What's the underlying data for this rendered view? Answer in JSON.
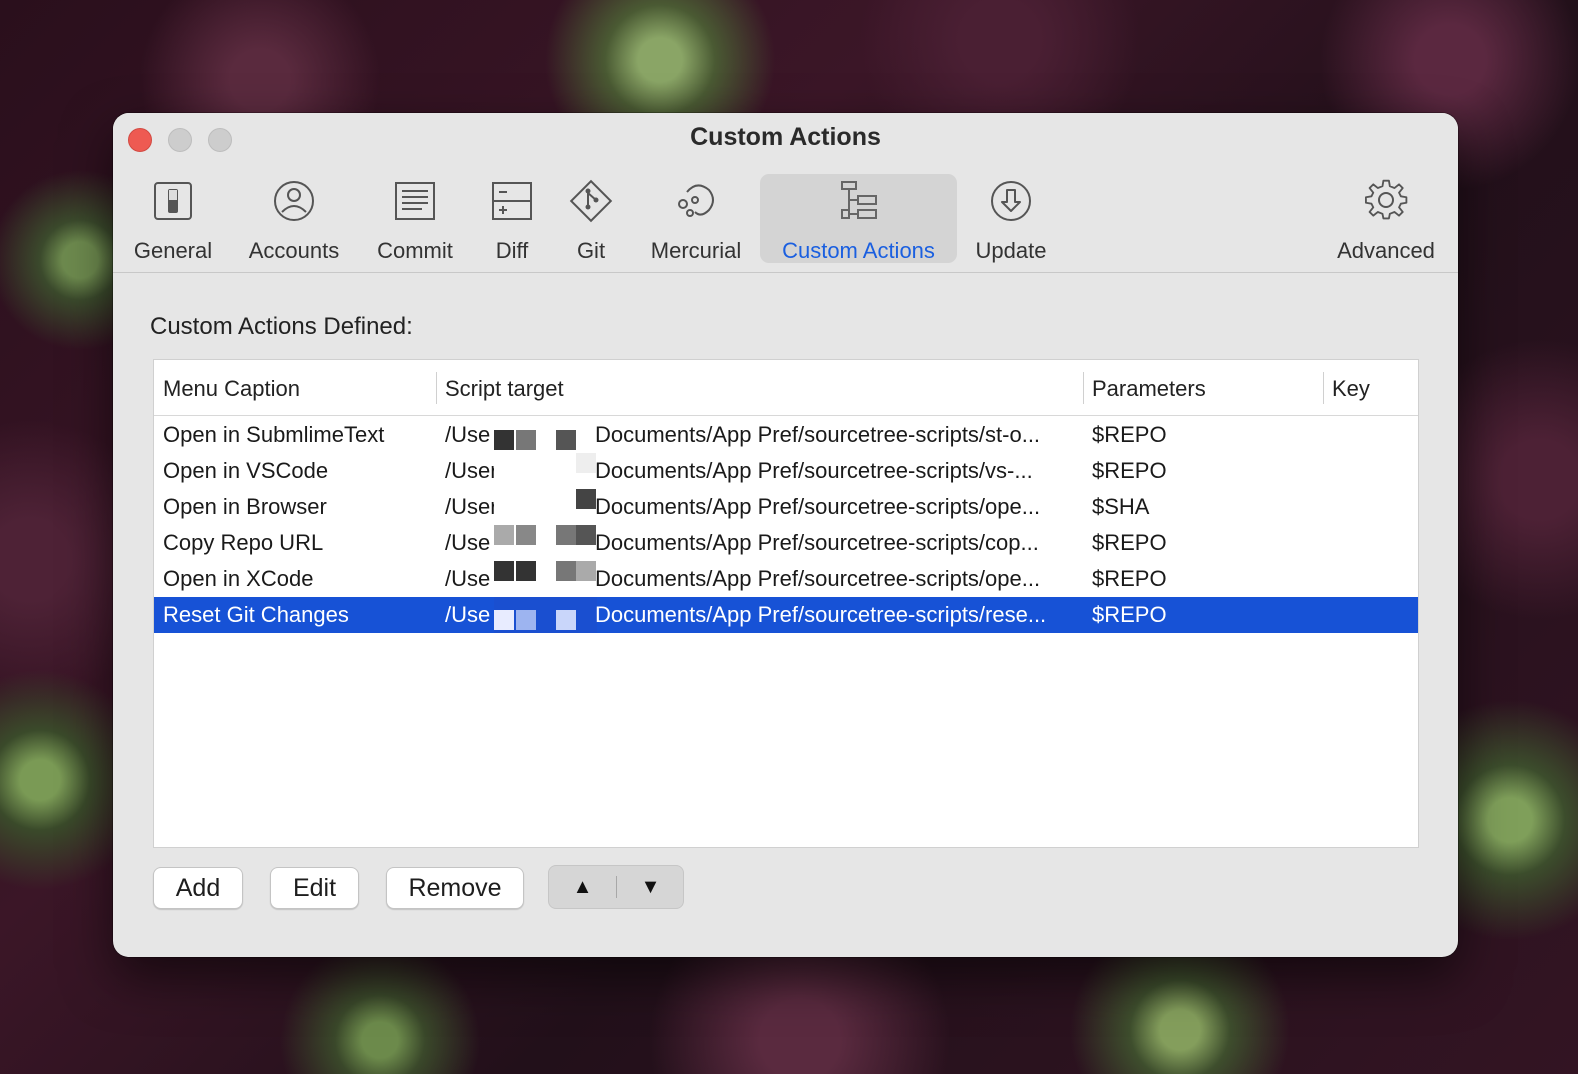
{
  "window": {
    "title": "Custom Actions"
  },
  "toolbar": {
    "items": [
      {
        "label": "General",
        "icon": "general-icon"
      },
      {
        "label": "Accounts",
        "icon": "accounts-icon"
      },
      {
        "label": "Commit",
        "icon": "commit-icon"
      },
      {
        "label": "Diff",
        "icon": "diff-icon"
      },
      {
        "label": "Git",
        "icon": "git-icon"
      },
      {
        "label": "Mercurial",
        "icon": "mercurial-icon"
      },
      {
        "label": "Custom Actions",
        "icon": "custom-actions-icon",
        "selected": true
      },
      {
        "label": "Update",
        "icon": "update-icon"
      },
      {
        "label": "Advanced",
        "icon": "gear-icon"
      }
    ],
    "selected_color": "#1a5fe0"
  },
  "main": {
    "section_title": "Custom Actions Defined:",
    "table": {
      "columns": [
        "Menu Caption",
        "Script target",
        "Parameters",
        "Key"
      ],
      "rows": [
        {
          "caption": "Open in SubmlimeText",
          "target_prefix": "/Use",
          "target_suffix": "Documents/App Pref/sourcetree-scripts/st-o...",
          "params": "$REPO",
          "key": ""
        },
        {
          "caption": "Open in VSCode",
          "target_prefix": "/User",
          "target_suffix": "Documents/App Pref/sourcetree-scripts/vs-...",
          "params": "$REPO",
          "key": ""
        },
        {
          "caption": "Open in Browser",
          "target_prefix": "/User",
          "target_suffix": "Documents/App Pref/sourcetree-scripts/ope...",
          "params": "$SHA",
          "key": ""
        },
        {
          "caption": "Copy Repo URL",
          "target_prefix": "/Use",
          "target_suffix": "Documents/App Pref/sourcetree-scripts/cop...",
          "params": "$REPO",
          "key": ""
        },
        {
          "caption": "Open in XCode",
          "target_prefix": "/Use",
          "target_suffix": "Documents/App Pref/sourcetree-scripts/ope...",
          "params": "$REPO",
          "key": ""
        },
        {
          "caption": "Reset Git Changes",
          "target_prefix": "/Use",
          "target_suffix": "Documents/App Pref/sourcetree-scripts/rese...",
          "params": "$REPO",
          "key": "",
          "selected": true
        }
      ],
      "selection_color": "#1752d6"
    },
    "buttons": {
      "add": "Add",
      "edit": "Edit",
      "remove": "Remove",
      "move_up": "▲",
      "move_down": "▼"
    }
  }
}
